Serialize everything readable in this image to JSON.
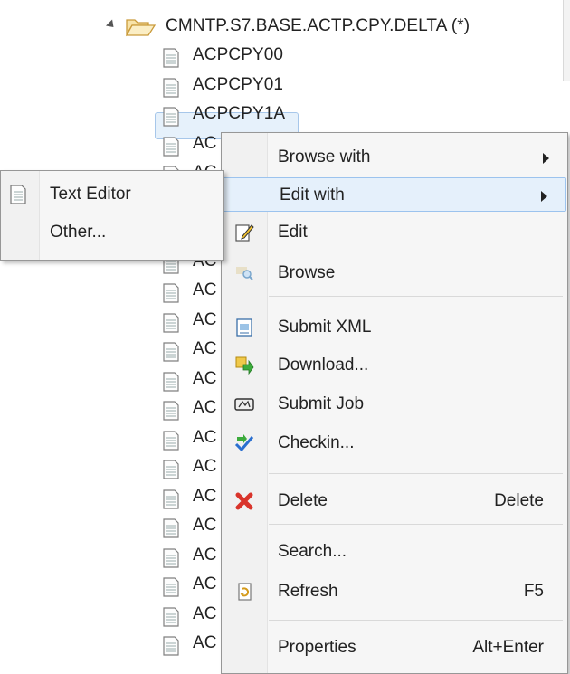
{
  "tree": {
    "root_label": "CMNTP.S7.BASE.ACTP.CPY.DELTA (*)",
    "items": [
      {
        "label": "ACPCPY00"
      },
      {
        "label": "ACPCPY01"
      },
      {
        "label": "ACPCPY1A",
        "selected": true
      },
      {
        "label": "AC"
      },
      {
        "label": "AC"
      },
      {
        "label": "AC"
      },
      {
        "label": "AC"
      },
      {
        "label": "AC"
      },
      {
        "label": "AC"
      },
      {
        "label": "AC"
      },
      {
        "label": "AC"
      },
      {
        "label": "AC"
      },
      {
        "label": "AC"
      },
      {
        "label": "AC"
      },
      {
        "label": "AC"
      },
      {
        "label": "AC"
      },
      {
        "label": "AC"
      },
      {
        "label": "AC"
      },
      {
        "label": "AC"
      },
      {
        "label": "AC"
      },
      {
        "label": "AC"
      }
    ]
  },
  "context_menu": {
    "browse_with": "Browse with",
    "edit_with": "Edit with",
    "edit": "Edit",
    "browse": "Browse",
    "submit_xml": "Submit XML",
    "download": "Download...",
    "submit_job": "Submit Job",
    "checkin": "Checkin...",
    "delete": "Delete",
    "delete_shortcut": "Delete",
    "search": "Search...",
    "refresh": "Refresh",
    "refresh_shortcut": "F5",
    "properties": "Properties",
    "properties_shortcut": "Alt+Enter"
  },
  "submenu": {
    "text_editor": "Text Editor",
    "other": "Other..."
  },
  "colors": {
    "selection": "#e6f1fb",
    "hover": "#e5f0fb",
    "delete_icon": "#d9342b"
  }
}
